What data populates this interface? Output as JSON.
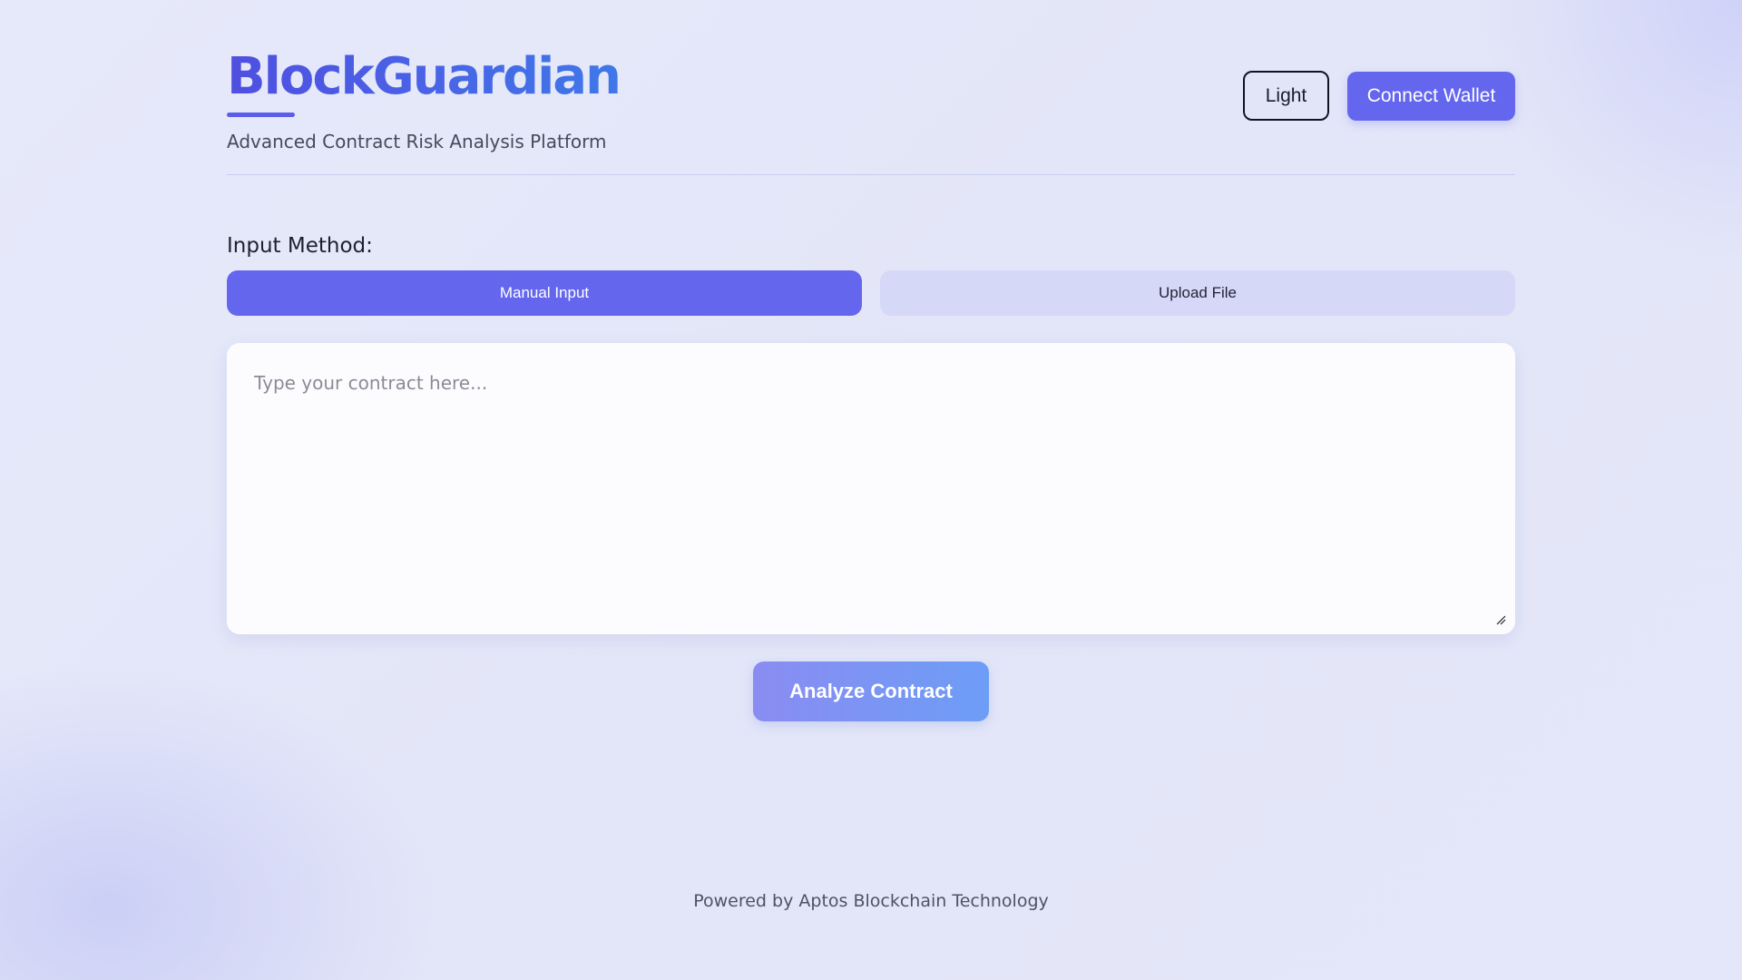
{
  "header": {
    "title": "BlockGuardian",
    "subtitle": "Advanced Contract Risk Analysis Platform",
    "theme_toggle_label": "Light",
    "connect_wallet_label": "Connect Wallet"
  },
  "input_method": {
    "label": "Input Method:",
    "tabs": [
      {
        "label": "Manual Input",
        "active": true
      },
      {
        "label": "Upload File",
        "active": false
      }
    ]
  },
  "contract_input": {
    "placeholder": "Type your contract here...",
    "value": ""
  },
  "analyze_button_label": "Analyze Contract",
  "footer": {
    "text": "Powered by Aptos Blockchain Technology"
  },
  "colors": {
    "accent": "#6467ee",
    "tab_inactive": "#d6d8f8",
    "background": "#e4e7f9"
  }
}
